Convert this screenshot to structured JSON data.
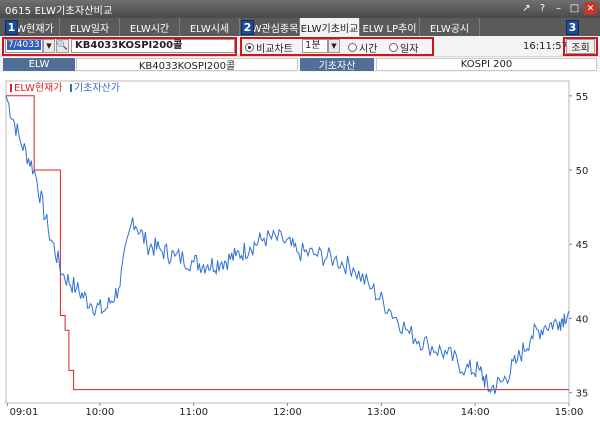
{
  "window": {
    "title": "0615 ELW기초자산비교"
  },
  "tabs": [
    {
      "label": "ELW현재가"
    },
    {
      "label": "ELW일자"
    },
    {
      "label": "ELW시간"
    },
    {
      "label": "ELW시세"
    },
    {
      "label": "ELW관심종목"
    },
    {
      "label": "ELW기초비교"
    },
    {
      "label": "ELW LP추이"
    },
    {
      "label": "ELW공시"
    }
  ],
  "active_tab": "ELW기초비교",
  "toolbar": {
    "code_value": "7/4033",
    "name_value": "KB4033KOSPI200콜",
    "radio_compare": "비교차트",
    "interval_value": "1분",
    "radio_time": "시간",
    "radio_date": "일자",
    "clock": "16:11:57",
    "query_label": "조회"
  },
  "badges": [
    "1",
    "2",
    "3"
  ],
  "info": {
    "elw_label": "ELW",
    "elw_value": "KB4033KOSPI200콜",
    "base_label": "기초자산",
    "base_value": "KOSPI 200"
  },
  "colors": {
    "elw_series": "#e02020",
    "base_series": "#2f6fd6",
    "highlight": "#d1141b"
  },
  "chart_data": {
    "type": "line",
    "legend": [
      "ELW현재가",
      "기초자산가"
    ],
    "x_ticks": [
      "09:01",
      "10:00",
      "11:00",
      "12:00",
      "13:00",
      "14:00",
      "15:00"
    ],
    "y_ticks": [
      35,
      40,
      45,
      50,
      55
    ],
    "ylim": [
      34.3,
      56.0
    ],
    "series": [
      {
        "name": "ELW현재가",
        "color": "#e02020",
        "points": [
          [
            9.0,
            55.0
          ],
          [
            9.3,
            55.0
          ],
          [
            9.3,
            50.0
          ],
          [
            9.58,
            50.0
          ],
          [
            9.58,
            40.2
          ],
          [
            9.63,
            40.2
          ],
          [
            9.63,
            39.2
          ],
          [
            9.67,
            39.2
          ],
          [
            9.67,
            36.5
          ],
          [
            9.72,
            36.5
          ],
          [
            9.72,
            35.2
          ],
          [
            15.0,
            35.2
          ]
        ]
      },
      {
        "name": "기초자산가",
        "color": "#2f6fd6",
        "points": [
          [
            9.0,
            55.0
          ],
          [
            9.15,
            52.0
          ],
          [
            9.3,
            50.0
          ],
          [
            9.45,
            46.0
          ],
          [
            9.6,
            43.0
          ],
          [
            9.75,
            42.0
          ],
          [
            9.9,
            41.0
          ],
          [
            10.05,
            40.5
          ],
          [
            10.2,
            42.0
          ],
          [
            10.35,
            46.8
          ],
          [
            10.5,
            45.0
          ],
          [
            10.65,
            44.6
          ],
          [
            10.8,
            44.2
          ],
          [
            11.0,
            43.8
          ],
          [
            11.15,
            43.6
          ],
          [
            11.3,
            43.8
          ],
          [
            11.45,
            44.2
          ],
          [
            11.6,
            44.8
          ],
          [
            11.75,
            45.4
          ],
          [
            11.95,
            45.3
          ],
          [
            12.1,
            44.5
          ],
          [
            12.3,
            44.3
          ],
          [
            12.5,
            44.0
          ],
          [
            12.7,
            43.4
          ],
          [
            12.9,
            42.0
          ],
          [
            13.1,
            40.5
          ],
          [
            13.3,
            39.0
          ],
          [
            13.5,
            38.2
          ],
          [
            13.7,
            37.6
          ],
          [
            13.9,
            36.6
          ],
          [
            14.05,
            36.5
          ],
          [
            14.15,
            35.2
          ],
          [
            14.3,
            35.8
          ],
          [
            14.45,
            37.2
          ],
          [
            14.6,
            38.8
          ],
          [
            14.75,
            39.5
          ],
          [
            14.9,
            39.8
          ],
          [
            15.0,
            40.5
          ]
        ]
      }
    ]
  }
}
